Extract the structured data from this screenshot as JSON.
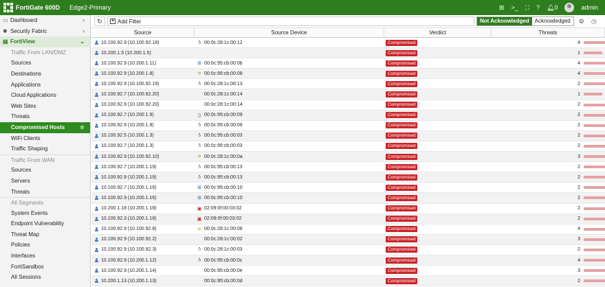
{
  "topbar": {
    "product": "FortiGate 600D",
    "hostname": "Edge2-Primary",
    "notif_count": "0",
    "user": "admin"
  },
  "sidebar": {
    "items": [
      {
        "label": "Dashboard",
        "kind": "top",
        "icon": "dashboard-icon",
        "glyph": "▭",
        "chev": "›"
      },
      {
        "label": "Security Fabric",
        "kind": "top",
        "icon": "security-fabric-icon",
        "glyph": "✱",
        "chev": "›"
      },
      {
        "label": "FortiView",
        "kind": "fv",
        "icon": "fortiview-icon",
        "glyph": "▤",
        "chev": "⌄"
      },
      {
        "label": "Traffic From LAN/DMZ",
        "kind": "hdr"
      },
      {
        "label": "Sources",
        "kind": "item"
      },
      {
        "label": "Destinations",
        "kind": "item"
      },
      {
        "label": "Applications",
        "kind": "item"
      },
      {
        "label": "Cloud Applications",
        "kind": "item"
      },
      {
        "label": "Web Sites",
        "kind": "item"
      },
      {
        "label": "Threats",
        "kind": "item"
      },
      {
        "label": "Compromised Hosts",
        "kind": "sel"
      },
      {
        "label": "WiFi Clients",
        "kind": "item"
      },
      {
        "label": "Traffic Shaping",
        "kind": "item"
      },
      {
        "label": "Traffic From WAN",
        "kind": "hdr sep"
      },
      {
        "label": "Sources",
        "kind": "item"
      },
      {
        "label": "Servers",
        "kind": "item"
      },
      {
        "label": "Threats",
        "kind": "item"
      },
      {
        "label": "All Segments",
        "kind": "hdr sep"
      },
      {
        "label": "System Events",
        "kind": "item"
      },
      {
        "label": "Endpoint Vulnerability",
        "kind": "item"
      },
      {
        "label": "Threat Map",
        "kind": "item"
      },
      {
        "label": "Policies",
        "kind": "item"
      },
      {
        "label": "Interfaces",
        "kind": "item"
      },
      {
        "label": "FortiSandbox",
        "kind": "item"
      },
      {
        "label": "All Sessions",
        "kind": "item"
      }
    ]
  },
  "toolbar": {
    "add_filter_label": "Add Filter",
    "seg_not_ack": "Not Acknowledged",
    "seg_ack": "Acknowledged"
  },
  "table": {
    "headers": [
      "Source",
      "Source Device",
      "Verdict",
      "Threats"
    ],
    "max_threats": 4,
    "rows": [
      {
        "source": "10.100.92.9 (10.100.92.18)",
        "device": "00:0c:28:1c:00:12",
        "os": "linux",
        "verdict": "Compromised",
        "threats": 4
      },
      {
        "source": "10.200.1.5 (10.200.1.5)",
        "device": "",
        "os": "",
        "verdict": "Compromised",
        "threats": 1
      },
      {
        "source": "10.100.92.9 (10.200.1.11)",
        "device": "00:0c:95:cb:00:0b",
        "os": "windows",
        "verdict": "Compromised",
        "threats": 4
      },
      {
        "source": "10.100.92.9 (10.200.1.8)",
        "device": "00:0c:95:cb:00:08",
        "os": "android",
        "verdict": "Compromised",
        "threats": 4
      },
      {
        "source": "10.100.92.9 (10.100.92.19)",
        "device": "00:0c:28:1c:00:13",
        "os": "linux",
        "verdict": "Compromised",
        "threats": 2
      },
      {
        "source": "10.100.92.7 (10.100.92.20)",
        "device": "00:0c:28:1c:00:14",
        "os": "apple",
        "verdict": "Compromised",
        "threats": 1
      },
      {
        "source": "10.100.92.9 (10.100.92.20)",
        "device": "00:0c:28:1c:00:14",
        "os": "apple",
        "verdict": "Compromised",
        "threats": 2
      },
      {
        "source": "10.100.92.7 (10.200.1.9)",
        "device": "00:0c:95:cb:00:09",
        "os": "phone",
        "verdict": "Compromised",
        "threats": 2
      },
      {
        "source": "10.100.92.9 (10.200.1.9)",
        "device": "00:0c:95:cb:00:09",
        "os": "linux",
        "verdict": "Compromised",
        "threats": 2
      },
      {
        "source": "10.100.92.5 (10.200.1.3)",
        "device": "00:0c:95:cb:00:03",
        "os": "linux",
        "verdict": "Compromised",
        "threats": 2
      },
      {
        "source": "10.100.92.7 (10.200.1.3)",
        "device": "00:0c:95:cb:00:03",
        "os": "linux",
        "verdict": "Compromised",
        "threats": 2
      },
      {
        "source": "10.100.92.9 (10.100.92.10)",
        "device": "00:0c:28:1c:00:0a",
        "os": "android",
        "verdict": "Compromised",
        "threats": 3
      },
      {
        "source": "10.100.92.7 (10.200.1.19)",
        "device": "00:0c:95:cb:00:13",
        "os": "linux",
        "verdict": "Compromised",
        "threats": 2
      },
      {
        "source": "10.100.92.9 (10.200.1.19)",
        "device": "00:0c:95:cb:00:13",
        "os": "linux",
        "verdict": "Compromised",
        "threats": 2
      },
      {
        "source": "10.100.92.7 (10.200.1.16)",
        "device": "00:0c:95:cb:00:10",
        "os": "windows",
        "verdict": "Compromised",
        "threats": 2
      },
      {
        "source": "10.100.92.9 (10.200.1.16)",
        "device": "00:0c:95:cb:00:10",
        "os": "windows",
        "verdict": "Compromised",
        "threats": 2
      },
      {
        "source": "10.200.1.18 (10.200.1.18)",
        "device": "02:09:0f:00:03:02",
        "os": "fortinet",
        "verdict": "Compromised",
        "threats": 2
      },
      {
        "source": "10.100.92.3 (10.200.1.18)",
        "device": "02:09:0f:00:03:02",
        "os": "fortinet",
        "verdict": "Compromised",
        "threats": 2
      },
      {
        "source": "10.100.92.9 (10.100.92.8)",
        "device": "00:0c:28:1c:00:08",
        "os": "android",
        "verdict": "Compromised",
        "threats": 4
      },
      {
        "source": "10.100.92.9 (10.100.92.2)",
        "device": "00:0c:28:1c:00:02",
        "os": "apple",
        "verdict": "Compromised",
        "threats": 3
      },
      {
        "source": "10.100.92.9 (10.100.92.3)",
        "device": "00:0c:28:1c:00:03",
        "os": "linux",
        "verdict": "Compromised",
        "threats": 2
      },
      {
        "source": "10.100.92.9 (10.200.1.12)",
        "device": "00:0c:95:cb:00:0c",
        "os": "linux",
        "verdict": "Compromised",
        "threats": 4
      },
      {
        "source": "10.100.92.9 (10.200.1.14)",
        "device": "00:0c:95:cb:00:0e",
        "os": "apple",
        "verdict": "Compromised",
        "threats": 3
      },
      {
        "source": "10.200.1.13 (10.200.1.13)",
        "device": "00:0c:95:cb:00:0d",
        "os": "apple",
        "verdict": "Compromised",
        "threats": 2
      }
    ]
  },
  "colors": {
    "brand": "#2e7d1e",
    "verdict": "#c8262a",
    "bar": "#e4a1a4"
  }
}
